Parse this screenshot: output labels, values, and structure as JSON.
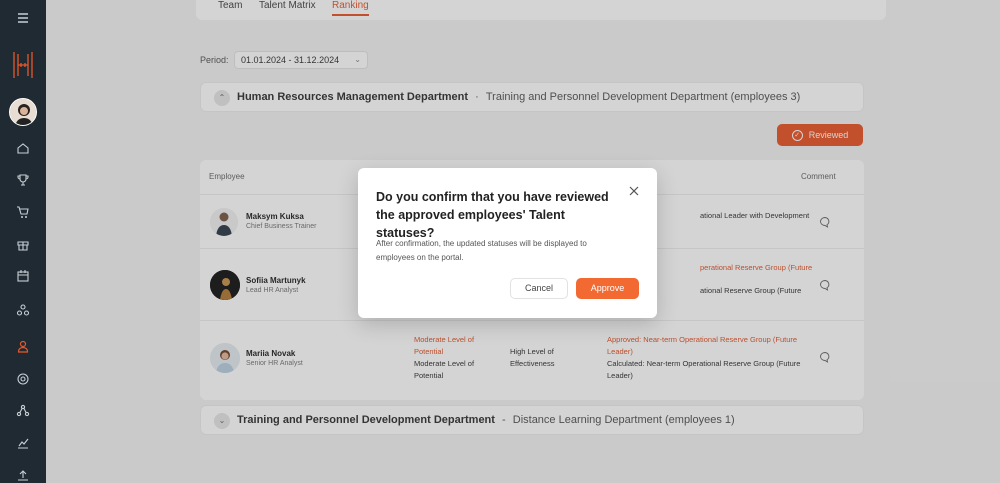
{
  "tabs": [
    {
      "label": "Team"
    },
    {
      "label": "Talent Matrix"
    },
    {
      "label": "Ranking"
    }
  ],
  "period": {
    "label": "Period:",
    "value": "01.01.2024 - 31.12.2024"
  },
  "groups": [
    {
      "title": "Human Resources Management Department",
      "separator": "·",
      "subtitle": "Training and Personnel Development Department  (employees 3)"
    },
    {
      "title": "Training and Personnel Development Department",
      "separator": "-",
      "subtitle": "Distance Learning Department  (employees 1)"
    }
  ],
  "reviewed_button": {
    "label": "Reviewed"
  },
  "table": {
    "headers": {
      "employee": "Employee",
      "comment": "Comment"
    },
    "rows": [
      {
        "name": "Maksym Kuksa",
        "position": "Chief Business Trainer",
        "status": "ational Leader with Development"
      },
      {
        "name": "Sofiia Martunyk",
        "position": "Lead HR Analyst",
        "status_approved": "perational Reserve Group (Future",
        "status_calculated": "ational Reserve Group (Future"
      },
      {
        "name": "Mariia Novak",
        "position": "Senior HR Analyst",
        "potential_red": "Moderate Level of Potential",
        "potential": "Moderate Level of Potential",
        "effectiveness": "High Level of Effectiveness",
        "approved": "Approved: Near-term Operational Reserve Group (Future Leader)",
        "calculated": "Calculated: Near-term Operational Reserve Group (Future Leader)"
      }
    ]
  },
  "modal": {
    "title": "Do you confirm that you have reviewed the approved employees' Talent statuses?",
    "body": "After confirmation, the updated statuses will be displayed to employees on the portal.",
    "cancel_label": "Cancel",
    "approve_label": "Approve"
  },
  "colors": {
    "accent": "#e8572a",
    "sidebar": "#1f2a33",
    "approve": "#f26a32"
  }
}
